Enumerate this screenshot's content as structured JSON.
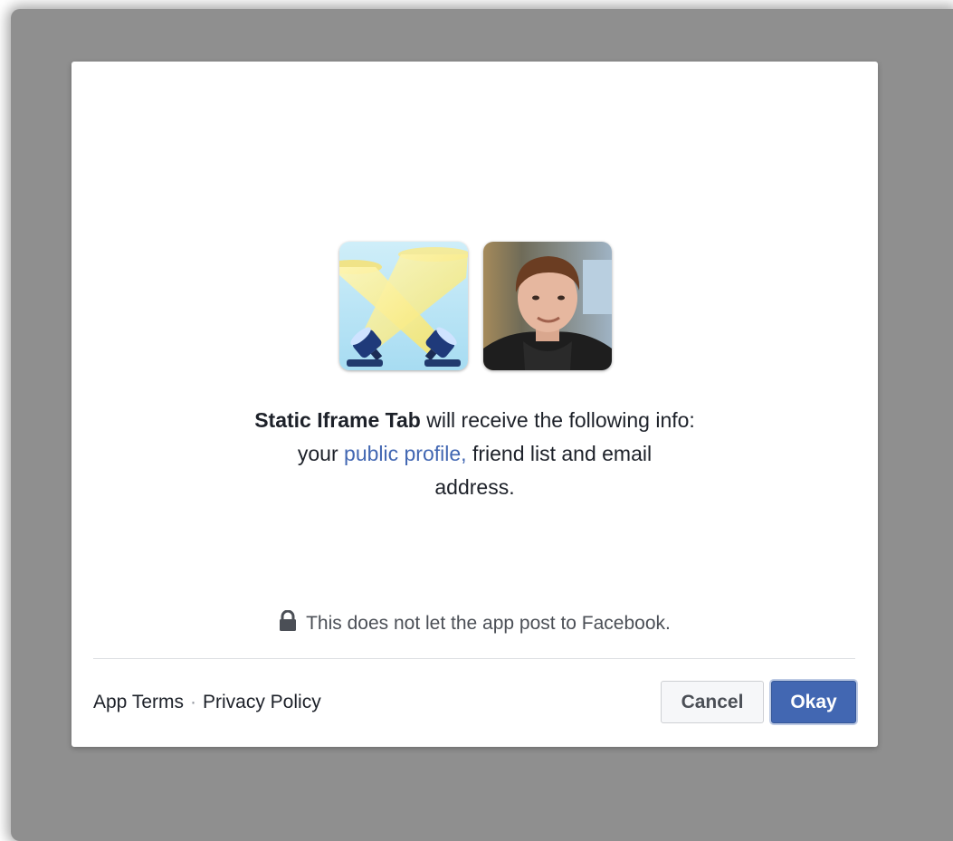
{
  "dialog": {
    "app_avatar": {
      "icon": "spotlights-icon"
    },
    "user_avatar": {
      "icon": "user-photo"
    },
    "message": {
      "app_name": "Static Iframe Tab",
      "line1_rest": " will receive the following info:",
      "line2_prefix": "your ",
      "public_profile_link": "public profile,",
      "line2_suffix": " friend list and email",
      "line3": "address."
    },
    "note": {
      "icon": "lock-icon",
      "text": "This does not let the app post to Facebook."
    },
    "footer": {
      "app_terms": "App Terms",
      "separator": "·",
      "privacy_policy": "Privacy Policy",
      "cancel_label": "Cancel",
      "okay_label": "Okay"
    }
  },
  "colors": {
    "overlay": "#8f8f8f",
    "link": "#4267b2",
    "primary_button": "#4267b2"
  }
}
